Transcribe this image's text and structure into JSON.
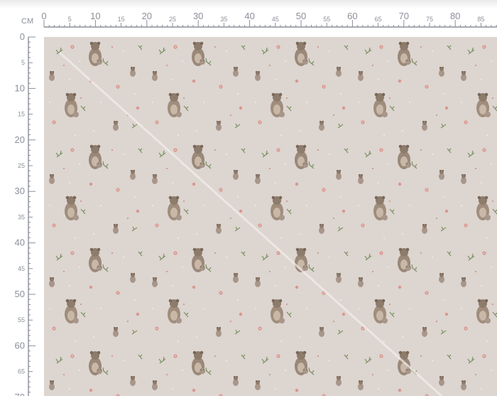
{
  "ruler": {
    "unit": "CM",
    "top_major": [
      "0",
      "10",
      "20",
      "30",
      "40",
      "50",
      "60",
      "70",
      "80"
    ],
    "top_minor": [
      "5",
      "15",
      "25",
      "35",
      "45",
      "55",
      "65",
      "75",
      "85"
    ],
    "left_major": [
      "0",
      "10",
      "20",
      "30",
      "40",
      "50",
      "60",
      "70"
    ],
    "left_minor": [
      "5",
      "15",
      "25",
      "35",
      "45",
      "55",
      "65"
    ]
  },
  "fabric": {
    "background_color": "#ddd5d0",
    "motifs": [
      "bear-family",
      "small-bear",
      "pink-flower",
      "green-sprig",
      "dot"
    ]
  }
}
